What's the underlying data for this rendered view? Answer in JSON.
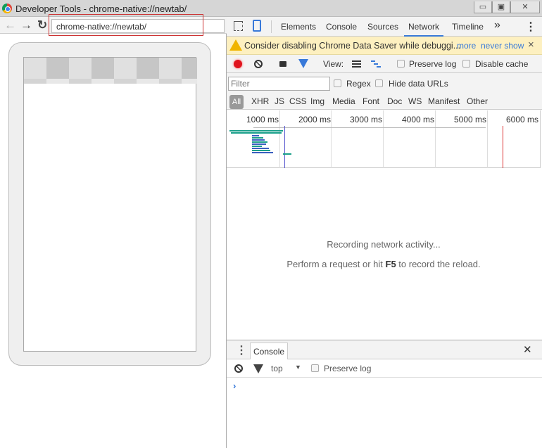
{
  "window": {
    "title": "Developer Tools - chrome-native://newtab/",
    "minimize": "▭",
    "restore": "▣",
    "close": "✕"
  },
  "browser": {
    "back": "←",
    "forward": "→",
    "reload": "↻",
    "url": "chrome-native://newtab/"
  },
  "devtools": {
    "tabs": [
      {
        "label": "Elements"
      },
      {
        "label": "Console"
      },
      {
        "label": "Sources"
      },
      {
        "label": "Network",
        "active": true
      },
      {
        "label": "Timeline"
      }
    ],
    "more_tabs": "»",
    "menu": "⋮",
    "warning": {
      "text": "Consider disabling Chrome Data Saver while debuggi...",
      "more": "more",
      "never_show": "never show",
      "close": "×"
    },
    "toolbar": {
      "view_label": "View:",
      "preserve_log": "Preserve log",
      "disable_cache": "Disable cache"
    },
    "filter": {
      "placeholder": "Filter",
      "regex": "Regex",
      "hide_data_urls": "Hide data URLs"
    },
    "types": [
      "All",
      "XHR",
      "JS",
      "CSS",
      "Img",
      "Media",
      "Font",
      "Doc",
      "WS",
      "Manifest",
      "Other"
    ],
    "timeline_ticks": [
      "1000 ms",
      "2000 ms",
      "3000 ms",
      "4000 ms",
      "5000 ms",
      "6000 ms"
    ],
    "empty": {
      "line1": "Recording network activity...",
      "line2_pre": "Perform a request or hit ",
      "line2_key": "F5",
      "line2_post": " to record the reload."
    },
    "drawer": {
      "tab": "Console",
      "close": "✕",
      "context": "top",
      "preserve_log": "Preserve log",
      "prompt": "›"
    }
  },
  "colors": {
    "accent": "#3879d9",
    "record": "#e0141e",
    "warning_bg": "#fdf0c0",
    "highlight_box": "#cc3333"
  }
}
